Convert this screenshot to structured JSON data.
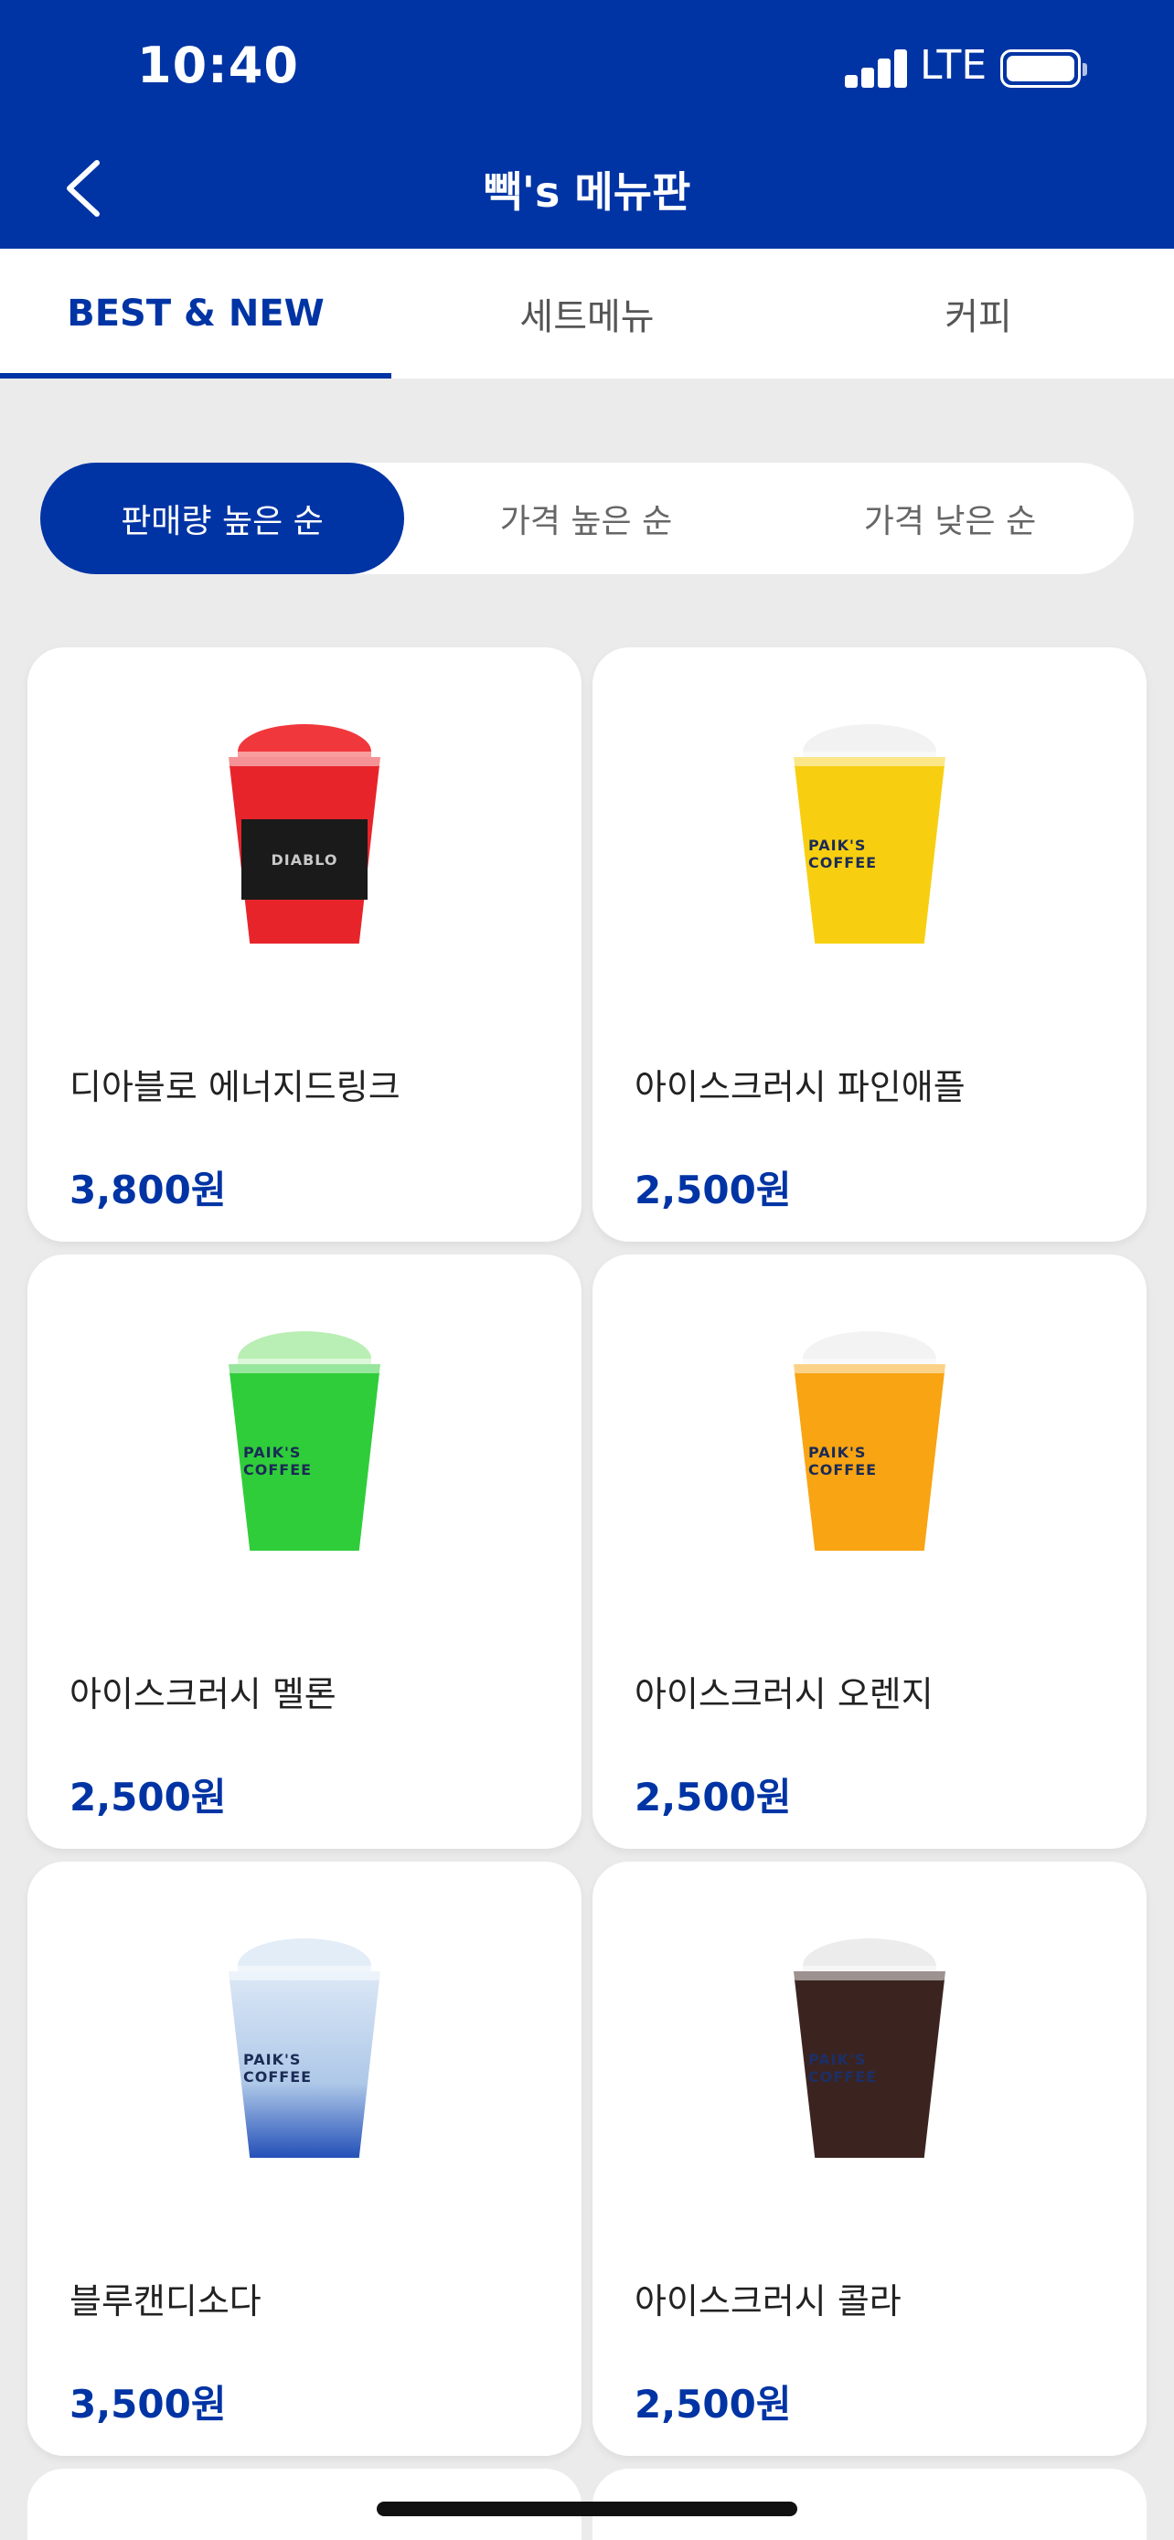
{
  "status": {
    "time": "10:40",
    "network": "LTE"
  },
  "header": {
    "title": "빽's 메뉴판"
  },
  "tabs": [
    {
      "label": "BEST & NEW",
      "active": true
    },
    {
      "label": "세트메뉴",
      "active": false
    },
    {
      "label": "커피",
      "active": false
    }
  ],
  "sort": [
    {
      "label": "판매량 높은 순",
      "active": true
    },
    {
      "label": "가격 높은 순",
      "active": false
    },
    {
      "label": "가격 낮은 순",
      "active": false
    }
  ],
  "products": [
    {
      "name": "디아블로 에너지드링크",
      "price": "3,800원",
      "cup_color": "#e8242b",
      "top_color": "#f0383c",
      "band_text": "DIABLO"
    },
    {
      "name": "아이스크러시 파인애플",
      "price": "2,500원",
      "cup_color": "#f7cf10",
      "top_color": "#f2f2f2",
      "band_text": "PAIK'S COFFEE"
    },
    {
      "name": "아이스크러시 멜론",
      "price": "2,500원",
      "cup_color": "#2fcd3a",
      "top_color": "#b9eeb4",
      "band_text": "PAIK'S COFFEE"
    },
    {
      "name": "아이스크러시 오렌지",
      "price": "2,500원",
      "cup_color": "#f8a413",
      "top_color": "#f3f3f3",
      "band_text": "PAIK'S COFFEE"
    },
    {
      "name": "블루캔디소다",
      "price": "3,500원",
      "cup_color": "#aec8e8",
      "top_color": "#e3edf8",
      "band_text": "PAIK'S COFFEE"
    },
    {
      "name": "아이스크러시 콜라",
      "price": "2,500원",
      "cup_color": "#3b2420",
      "top_color": "#ececec",
      "band_text": "PAIK'S COFFEE"
    }
  ],
  "colors": {
    "brand": "#0034a4",
    "background": "#ebebeb"
  }
}
